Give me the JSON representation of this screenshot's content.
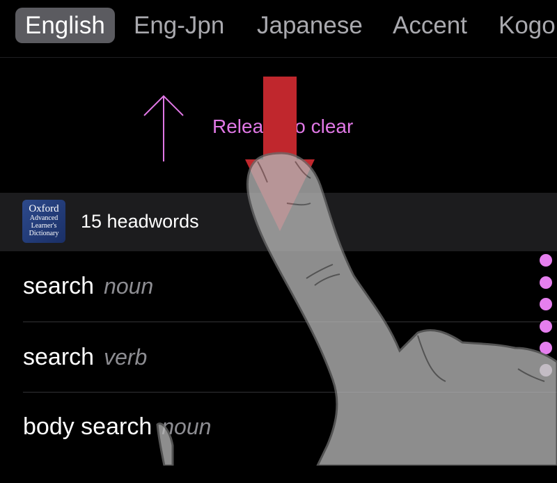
{
  "tabs": [
    {
      "label": "English",
      "active": true
    },
    {
      "label": "Eng-Jpn",
      "active": false
    },
    {
      "label": "Japanese",
      "active": false
    },
    {
      "label": "Accent",
      "active": false
    },
    {
      "label": "Kogo",
      "active": false
    }
  ],
  "pull_to_clear": {
    "text": "Release to clear",
    "arrow_color": "#e178e6",
    "gesture_arrow_color": "#c0272d"
  },
  "section": {
    "book_icon": {
      "line1": "Oxford",
      "line2": "Advanced",
      "line3": "Learner's",
      "line4": "Dictionary"
    },
    "count_text": "15 headwords"
  },
  "results": [
    {
      "word": "search",
      "pos": "noun"
    },
    {
      "word": "search",
      "pos": "verb"
    },
    {
      "word": "body search",
      "pos": "noun"
    }
  ],
  "index_dots": 6,
  "colors": {
    "background": "#000000",
    "accent": "#e57fee",
    "tab_active_bg": "#5b5b60"
  }
}
